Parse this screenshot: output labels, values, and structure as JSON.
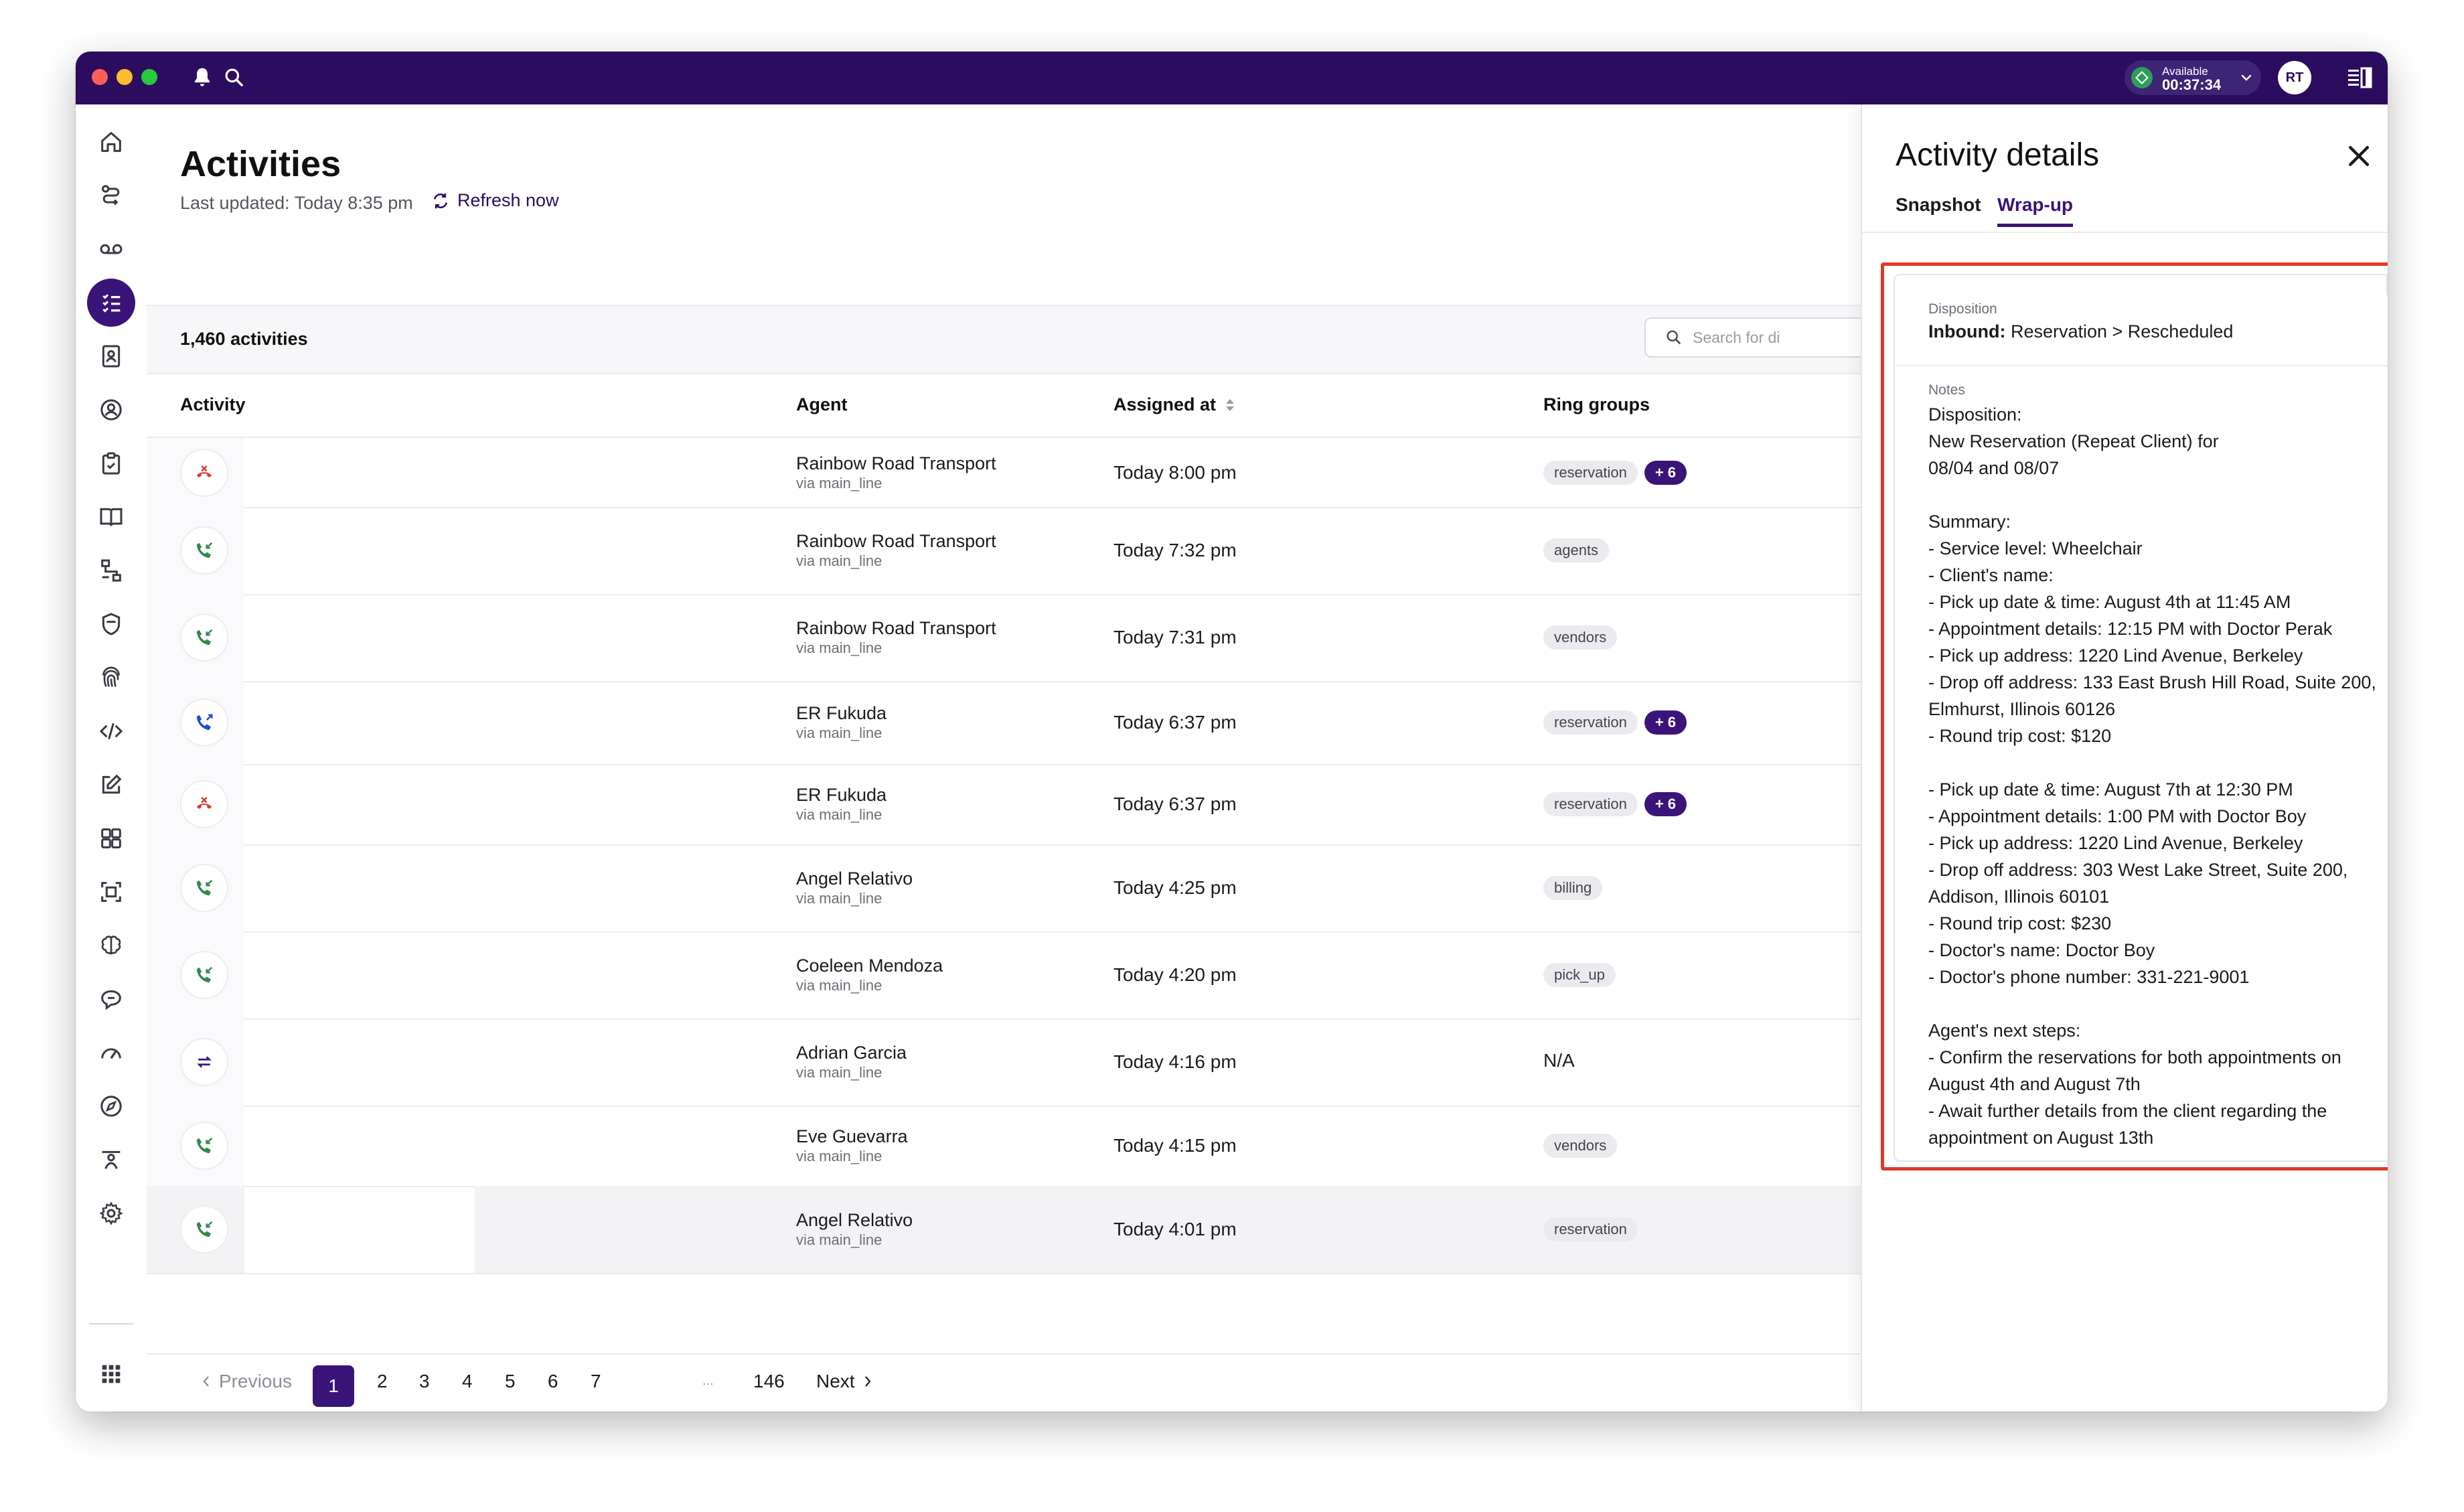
{
  "titlebar": {
    "status_label": "Available",
    "status_time": "00:37:34",
    "avatar_initials": "RT"
  },
  "page": {
    "title": "Activities",
    "last_updated": "Last updated: Today 8:35 pm",
    "refresh_label": "Refresh now",
    "count": "1,460 activities",
    "search_placeholder": "Search for di"
  },
  "table": {
    "headers": {
      "activity": "Activity",
      "agent": "Agent",
      "assigned": "Assigned at",
      "ring_groups": "Ring groups"
    },
    "rows": [
      {
        "type": "missed",
        "agent": "Rainbow Road Transport",
        "via": "via main_line",
        "assigned": "Today 8:00 pm",
        "groups": [
          "reservation"
        ],
        "more": "+ 6"
      },
      {
        "type": "inbound",
        "agent": "Rainbow Road Transport",
        "via": "via main_line",
        "assigned": "Today 7:32 pm",
        "groups": [
          "agents"
        ],
        "more": ""
      },
      {
        "type": "inbound",
        "agent": "Rainbow Road Transport",
        "via": "via main_line",
        "assigned": "Today 7:31 pm",
        "groups": [
          "vendors"
        ],
        "more": ""
      },
      {
        "type": "outbound",
        "agent": "ER Fukuda",
        "via": "via main_line",
        "assigned": "Today 6:37 pm",
        "groups": [
          "reservation"
        ],
        "more": "+ 6"
      },
      {
        "type": "missed",
        "agent": "ER Fukuda",
        "via": "via main_line",
        "assigned": "Today 6:37 pm",
        "groups": [
          "reservation"
        ],
        "more": "+ 6"
      },
      {
        "type": "inbound",
        "agent": "Angel Relativo",
        "via": "via main_line",
        "assigned": "Today 4:25 pm",
        "groups": [
          "billing"
        ],
        "more": ""
      },
      {
        "type": "inbound",
        "agent": "Coeleen Mendoza",
        "via": "via main_line",
        "assigned": "Today 4:20 pm",
        "groups": [
          "pick_up"
        ],
        "more": ""
      },
      {
        "type": "transfer",
        "agent": "Adrian Garcia",
        "via": "via main_line",
        "assigned": "Today 4:16 pm",
        "groups": [],
        "na": "N/A",
        "more": ""
      },
      {
        "type": "inbound",
        "agent": "Eve Guevarra",
        "via": "via main_line",
        "assigned": "Today 4:15 pm",
        "groups": [
          "vendors"
        ],
        "more": ""
      },
      {
        "type": "inbound",
        "agent": "Angel Relativo",
        "via": "via main_line",
        "assigned": "Today 4:01 pm",
        "groups": [
          "reservation"
        ],
        "more": ""
      }
    ]
  },
  "pager": {
    "prev": "Previous",
    "pages": [
      "1",
      "2",
      "3",
      "4",
      "5",
      "6",
      "7",
      "...",
      "146"
    ],
    "next": "Next"
  },
  "details": {
    "title": "Activity details",
    "tabs": [
      "Snapshot",
      "Wrap-up"
    ],
    "active_tab": "Wrap-up",
    "disposition_label": "Disposition",
    "disposition_bold": "Inbound:",
    "disposition_value": " Reservation > Rescheduled",
    "notes_label": "Notes",
    "notes": "Disposition:\nNew Reservation (Repeat Client) for\n08/04 and 08/07\n\nSummary:\n- Service level: Wheelchair\n- Client's name:\n- Pick up date & time: August 4th at 11:45 AM\n- Appointment details: 12:15 PM with Doctor Perak\n- Pick up address: 1220 Lind Avenue, Berkeley\n- Drop off address: 133 East Brush Hill Road, Suite 200,\nElmhurst, Illinois 60126\n- Round trip cost: $120\n\n- Pick up date & time: August 7th at 12:30 PM\n- Appointment details: 1:00 PM with Doctor Boy\n- Pick up address: 1220 Lind Avenue, Berkeley\n- Drop off address: 303 West Lake Street, Suite 200,\nAddison, Illinois 60101\n- Round trip cost: $230\n- Doctor's name: Doctor Boy\n- Doctor's phone number: 331-221-9001\n\nAgent's next steps:\n- Confirm the reservations for both appointments on\nAugust 4th and August 7th\n- Await further details from the client regarding the\nappointment on August 13th"
  },
  "colors": {
    "brand": "#2b0c5e",
    "accent": "#3a1478",
    "missed": "#d6392b",
    "inbound": "#2f8a4b",
    "outbound": "#1c4fd0",
    "highlight_box": "#e0392b"
  }
}
